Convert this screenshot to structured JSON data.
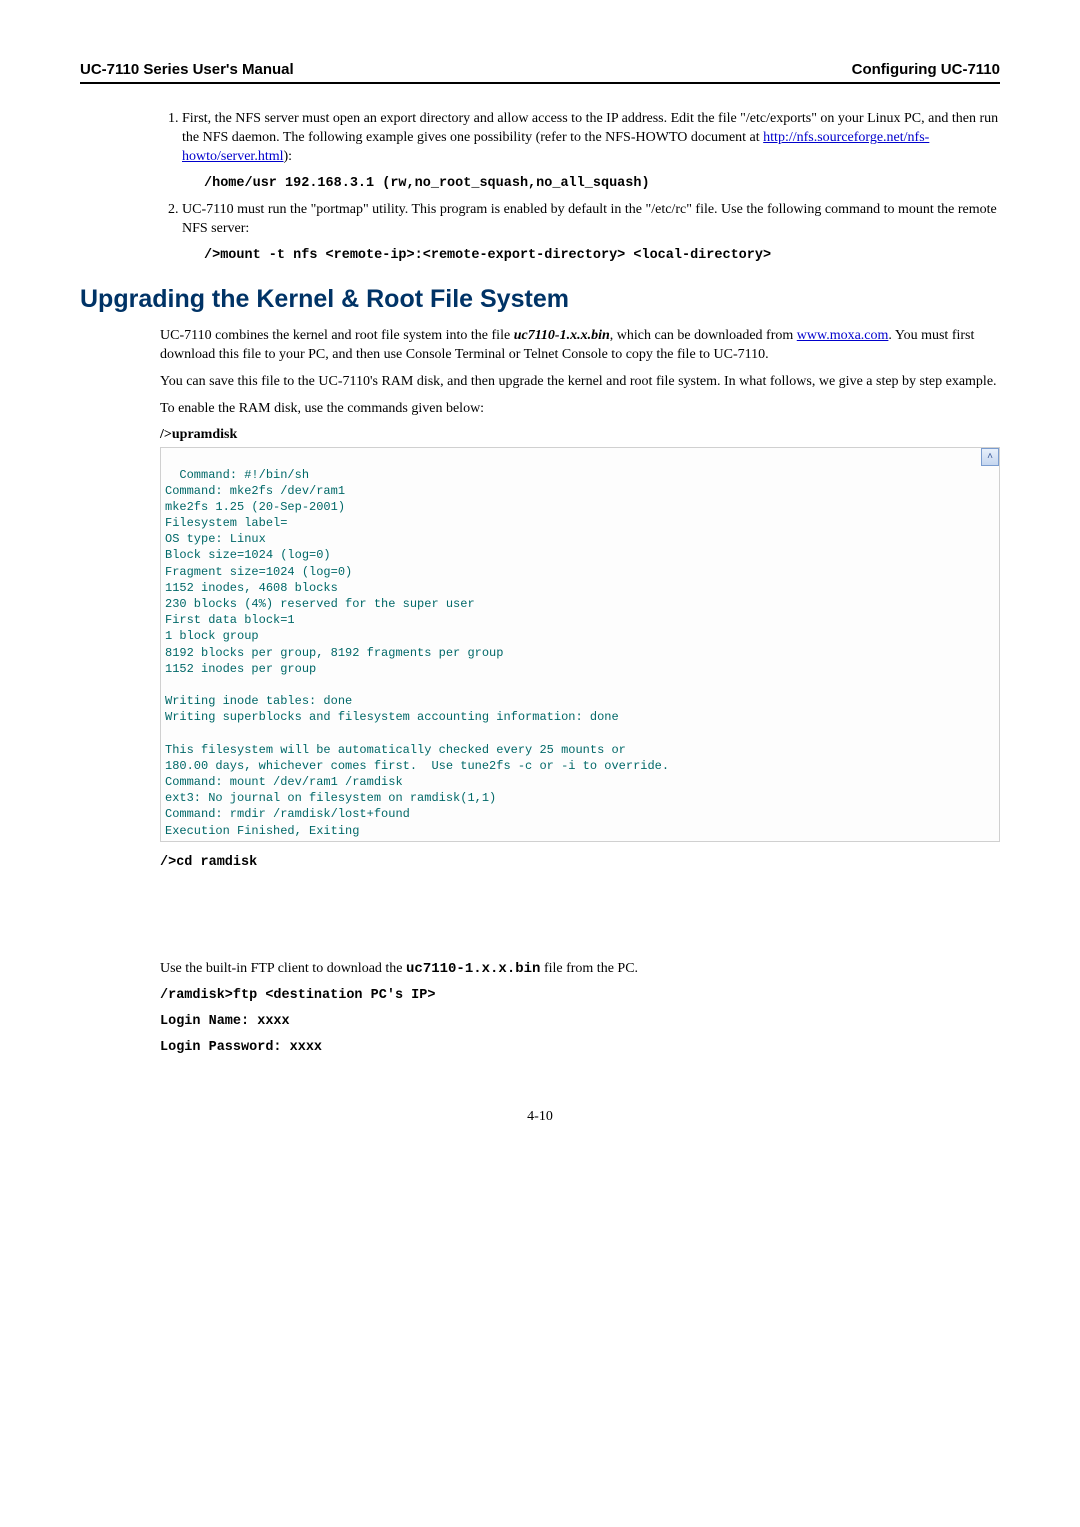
{
  "header": {
    "left": "UC-7110 Series User's Manual",
    "right": "Configuring UC-7110"
  },
  "list": {
    "item1": {
      "text_a": "First, the NFS server must open an export directory and allow access to the IP address. Edit the file \"/etc/exports\" on your Linux PC, and then run the NFS daemon. The following example gives one possibility (refer to the NFS-HOWTO document at ",
      "link": "http://nfs.sourceforge.net/nfs-howto/server.html",
      "text_b": "):",
      "code": "/home/usr 192.168.3.1 (rw,no_root_squash,no_all_squash)"
    },
    "item2": {
      "text": "UC-7110 must run the \"portmap\" utility. This program is enabled by default in the \"/etc/rc\" file. Use the following command to mount the remote NFS server:",
      "code": "/>mount -t nfs <remote-ip>:<remote-export-directory> <local-directory>"
    }
  },
  "heading": "Upgrading the Kernel & Root File System",
  "para1": {
    "a": "UC-7110 combines the kernel and root file system into the file ",
    "file": "uc7110-1.x.x.bin",
    "b": ", which can be downloaded from ",
    "link": "www.moxa.com",
    "c": ". You must first download this file to your PC, and then use Console Terminal or Telnet Console to copy the file to UC-7110."
  },
  "para2": "You can save this file to the UC-7110's RAM disk, and then upgrade the kernel and root file system. In what follows, we give a step by step example.",
  "para3": "To enable the RAM disk, use the commands given below:",
  "cmd1": "/>upramdisk",
  "terminal": "Command: #!/bin/sh\nCommand: mke2fs /dev/ram1\nmke2fs 1.25 (20-Sep-2001)\nFilesystem label=\nOS type: Linux\nBlock size=1024 (log=0)\nFragment size=1024 (log=0)\n1152 inodes, 4608 blocks\n230 blocks (4%) reserved for the super user\nFirst data block=1\n1 block group\n8192 blocks per group, 8192 fragments per group\n1152 inodes per group\n\nWriting inode tables: done\nWriting superblocks and filesystem accounting information: done\n\nThis filesystem will be automatically checked every 25 mounts or\n180.00 days, whichever comes first.  Use tune2fs -c or -i to override.\nCommand: mount /dev/ram1 /ramdisk\next3: No journal on filesystem on ramdisk(1,1)\nCommand: rmdir /ramdisk/lost+found\nExecution Finished, Exiting",
  "cmd2": "/>cd ramdisk",
  "para4": {
    "a": "Use the built-in FTP client to download the ",
    "file": "uc7110-1.x.x.bin",
    "b": " file from the PC."
  },
  "code_lines": {
    "l1": "/ramdisk>ftp  <destination PC's IP>",
    "l2": "Login Name: xxxx",
    "l3": "Login Password: xxxx"
  },
  "page_num": "4-10",
  "scroll_arrow": "˄"
}
